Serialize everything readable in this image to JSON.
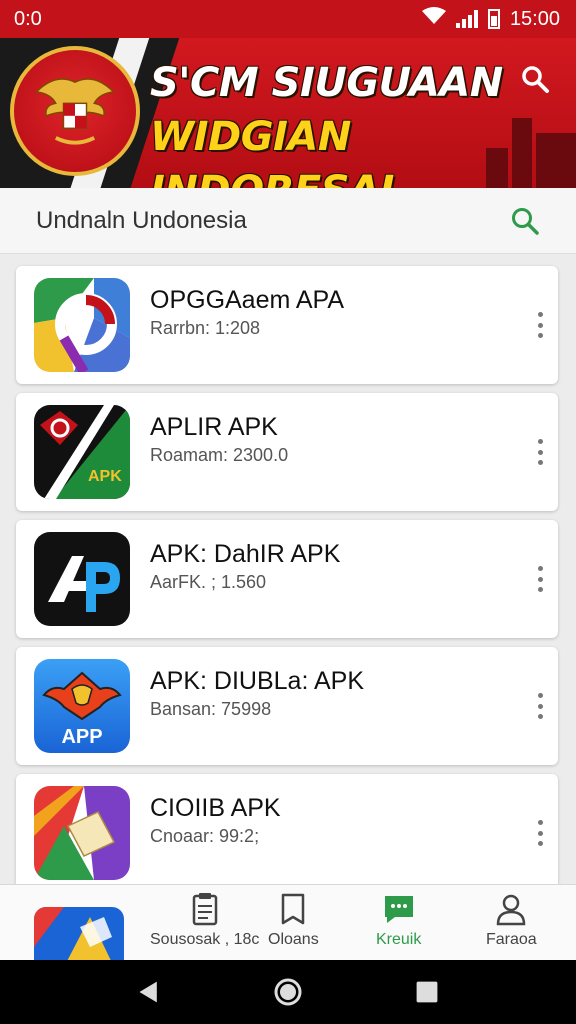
{
  "status_bar": {
    "left_time": "0:0",
    "right_time": "15:00"
  },
  "banner": {
    "title_line1": "S'CM SIUGUAAN",
    "title_line2": "WIDGIAN INDORESAI"
  },
  "search": {
    "query": "Undnaln Undonesia"
  },
  "apps": [
    {
      "name": "OPGGAaem APA",
      "meta": "Rarrbn: 1:208"
    },
    {
      "name": "APLIR APK",
      "meta": "Roamam: 2300.0"
    },
    {
      "name": "APK: DahIR APK",
      "meta": "AarFK. ; 1.560"
    },
    {
      "name": "APK: DIUBLa: APK",
      "meta": "Bansan: 75998"
    },
    {
      "name": "CIOIIB APK",
      "meta": "Cnoaar: 99:2;"
    }
  ],
  "app_icon_labels": {
    "app2": "APK",
    "app4": "APP"
  },
  "bottom_nav": {
    "item1": "Sousosak , 18c",
    "item2": "Oloans",
    "item3": "Kreuik",
    "item4": "Faraoa"
  },
  "colors": {
    "accent": "#c4121a",
    "gold": "#ffd21a",
    "search_green": "#2e9b4a",
    "active_nav": "#2e9b4a"
  },
  "icons": {
    "status": [
      "wifi-icon",
      "signal-icon",
      "battery-icon"
    ],
    "banner": [
      "emblem-garuda-icon",
      "search-icon"
    ],
    "nav": [
      "clipboard-icon",
      "bookmark-icon",
      "chat-icon",
      "person-icon"
    ],
    "system": [
      "back-icon",
      "home-icon",
      "recents-icon"
    ]
  }
}
